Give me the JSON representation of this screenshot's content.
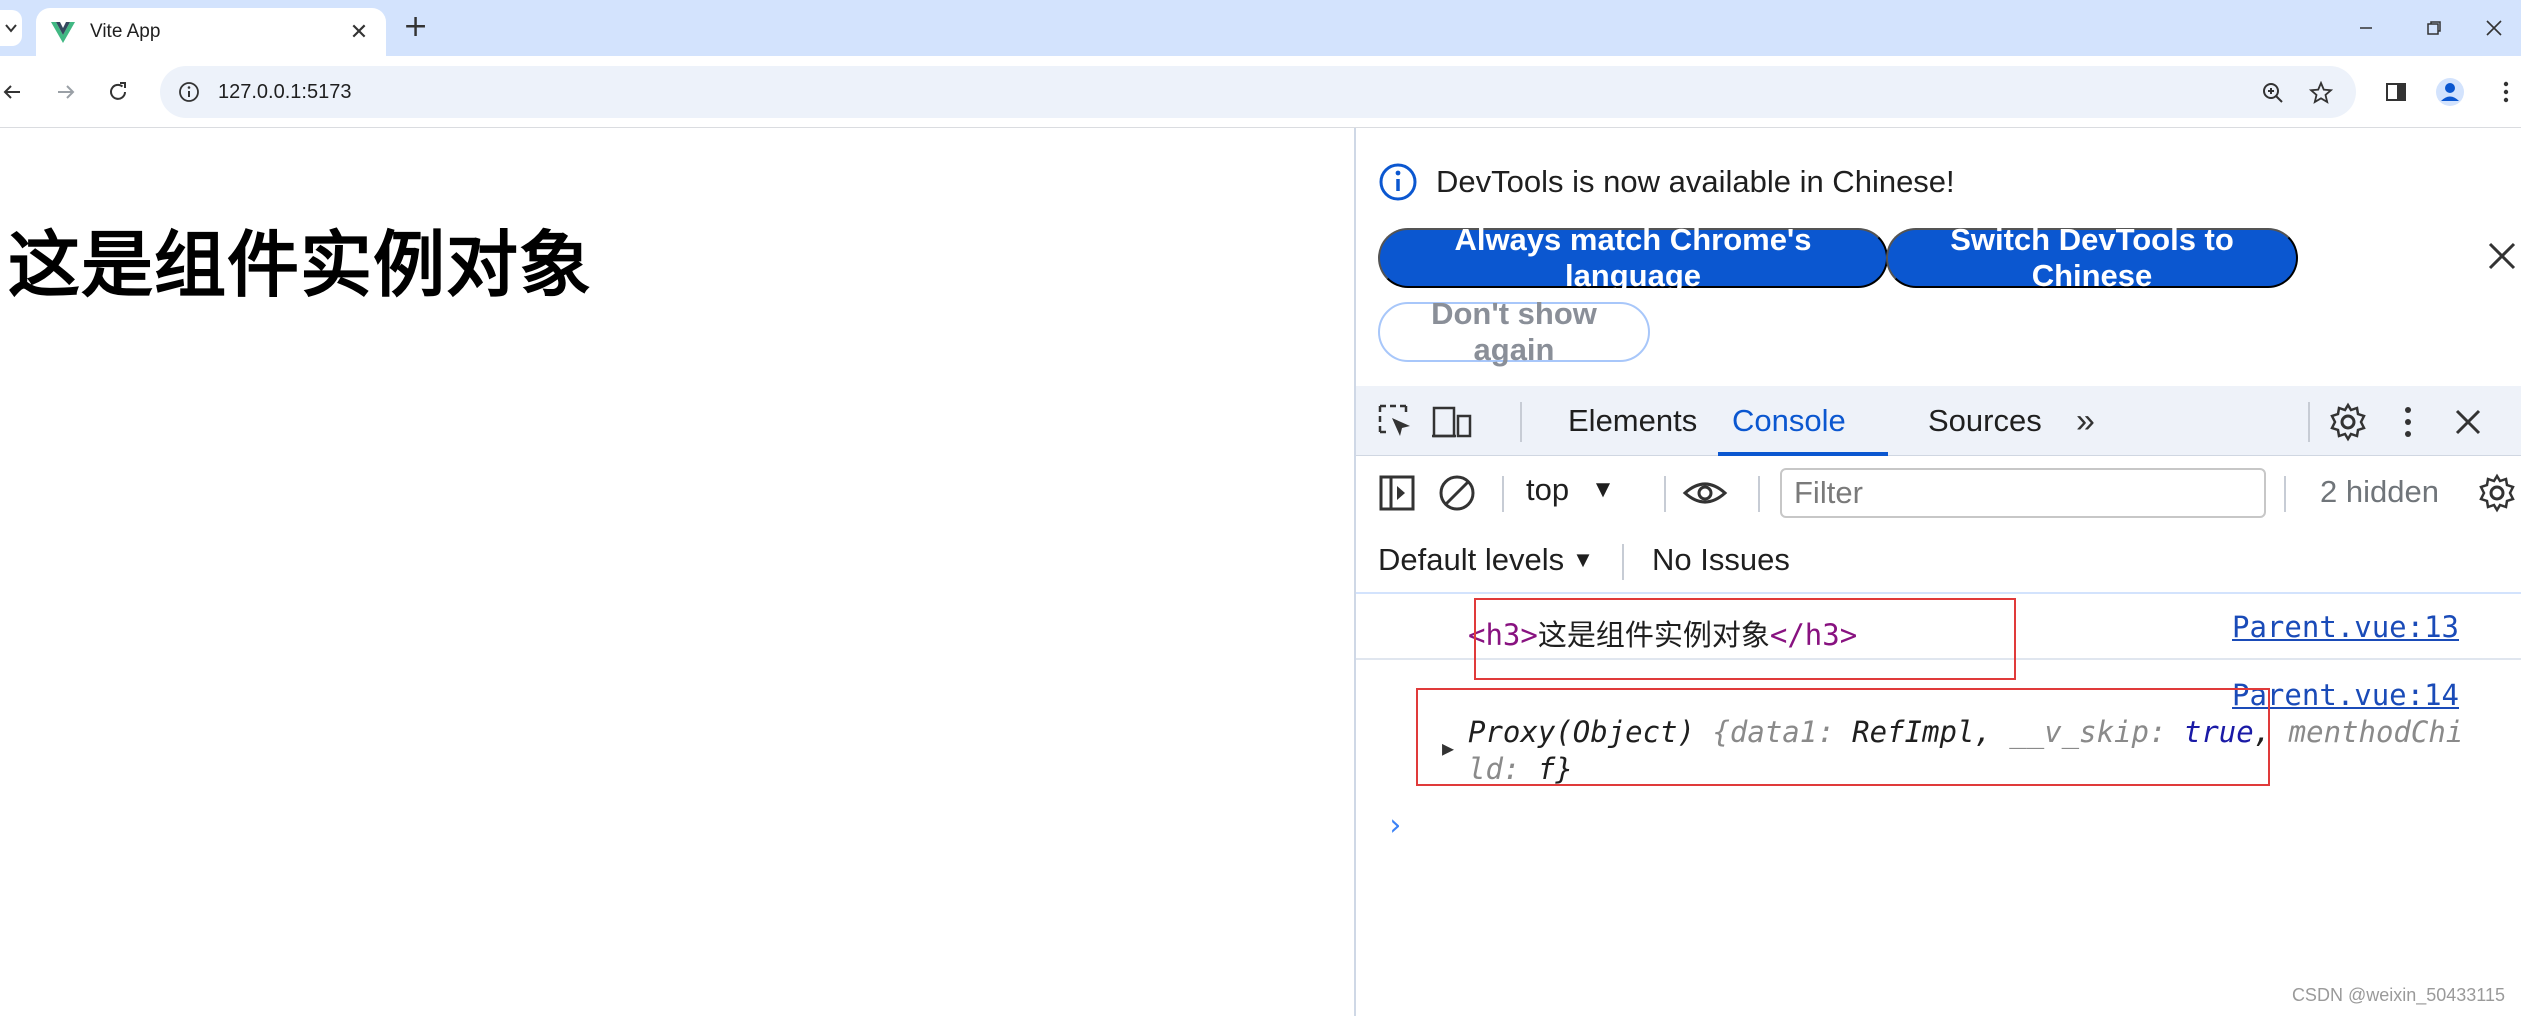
{
  "browser": {
    "tab_title": "Vite App",
    "tab_search_icon": "chevron-down-icon",
    "new_tab_label": "+",
    "url": "127.0.0.1:5173"
  },
  "page": {
    "heading": "这是组件实例对象"
  },
  "devtools": {
    "infobar": {
      "message": "DevTools is now available in Chinese!",
      "btn_always_match": "Always match Chrome's language",
      "btn_switch_chinese": "Switch DevTools to Chinese",
      "btn_dont_show": "Don't show again"
    },
    "tabs": {
      "elements": "Elements",
      "console": "Console",
      "sources": "Sources",
      "more": "»"
    },
    "console_toolbar": {
      "context": "top",
      "filter_placeholder": "Filter",
      "hidden_count": "2 hidden",
      "levels": "Default levels",
      "issues": "No Issues"
    },
    "messages": [
      {
        "open_tag": "<h3>",
        "text": "这是组件实例对象",
        "close_tag": "</h3>",
        "source": "Parent.vue:13"
      },
      {
        "source": "Parent.vue:14",
        "preview_prefix": "Proxy(Object) ",
        "brace_open": "{",
        "k1": "data1",
        "v1": "RefImpl",
        "k2": "__v_skip",
        "v2": "true",
        "k3": "menthodChild",
        "v3": "f",
        "brace_close": "}"
      }
    ],
    "prompt": "›"
  },
  "watermark": "CSDN @weixin_50433115",
  "colors": {
    "tabstrip": "#d3e3fd",
    "accent": "#0b57d0",
    "tag": "#881280",
    "annotation": "#e03a3a"
  }
}
